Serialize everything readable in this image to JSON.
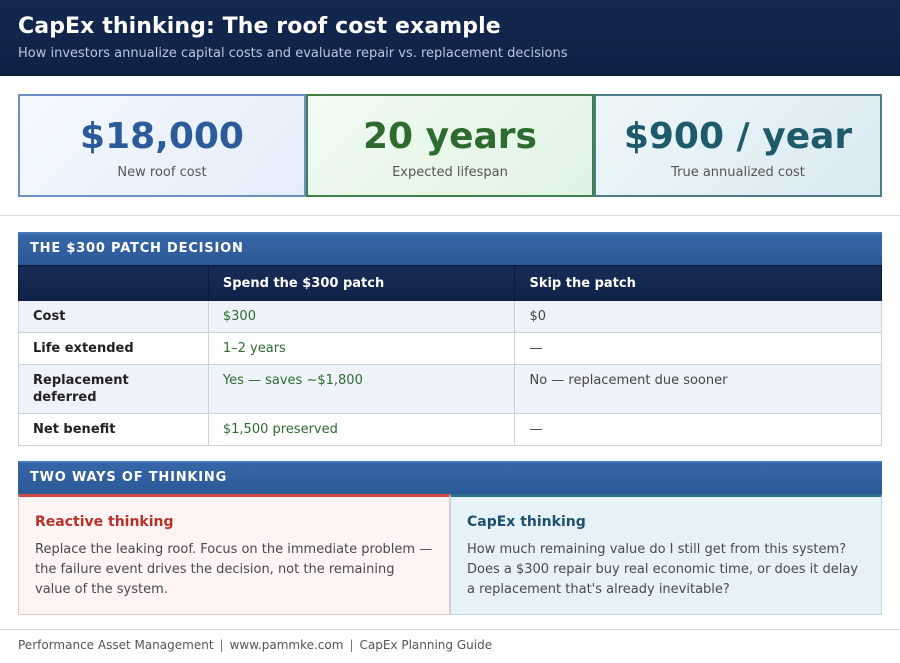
{
  "header": {
    "title": "CapEx thinking: The roof cost example",
    "subtitle": "How investors annualize capital costs and evaluate repair vs. replacement decisions"
  },
  "stats": [
    {
      "value": "$18,000",
      "label": "New roof cost"
    },
    {
      "value": "20 years",
      "label": "Expected lifespan"
    },
    {
      "value": "$900 / year",
      "label": "True annualized cost"
    }
  ],
  "patch_section": {
    "title": "THE $300 PATCH DECISION",
    "columns": [
      "",
      "Spend the $300 patch",
      "Skip the patch"
    ],
    "rows": [
      {
        "label": "Cost",
        "spend": "$300",
        "skip": "$0"
      },
      {
        "label": "Life extended",
        "spend": "1–2 years",
        "skip": "—"
      },
      {
        "label": "Replacement deferred",
        "spend": "Yes — saves ~$1,800",
        "skip": "No — replacement due sooner"
      },
      {
        "label": "Net benefit",
        "spend": "$1,500 preserved",
        "skip": "—"
      }
    ]
  },
  "thinking_section": {
    "title": "TWO WAYS OF THINKING",
    "reactive": {
      "title": "Reactive thinking",
      "body": "Replace the leaking roof. Focus on the immediate problem — the failure event drives the decision, not the remaining value of the system."
    },
    "capex": {
      "title": "CapEx thinking",
      "body": "How much remaining value do I still get from this system? Does a $300 repair buy real economic time, or does it delay a replacement that's already inevitable?"
    }
  },
  "footer": {
    "org": "Performance Asset Management",
    "site": "www.pammke.com",
    "guide": "CapEx Planning Guide",
    "separator": "|"
  },
  "colors": {
    "header_bg": "#14284f",
    "section_bar": "#3766a8",
    "positive_green": "#2e6b2f",
    "reactive_red": "#b8322a",
    "capex_blue": "#1f4f6e"
  }
}
